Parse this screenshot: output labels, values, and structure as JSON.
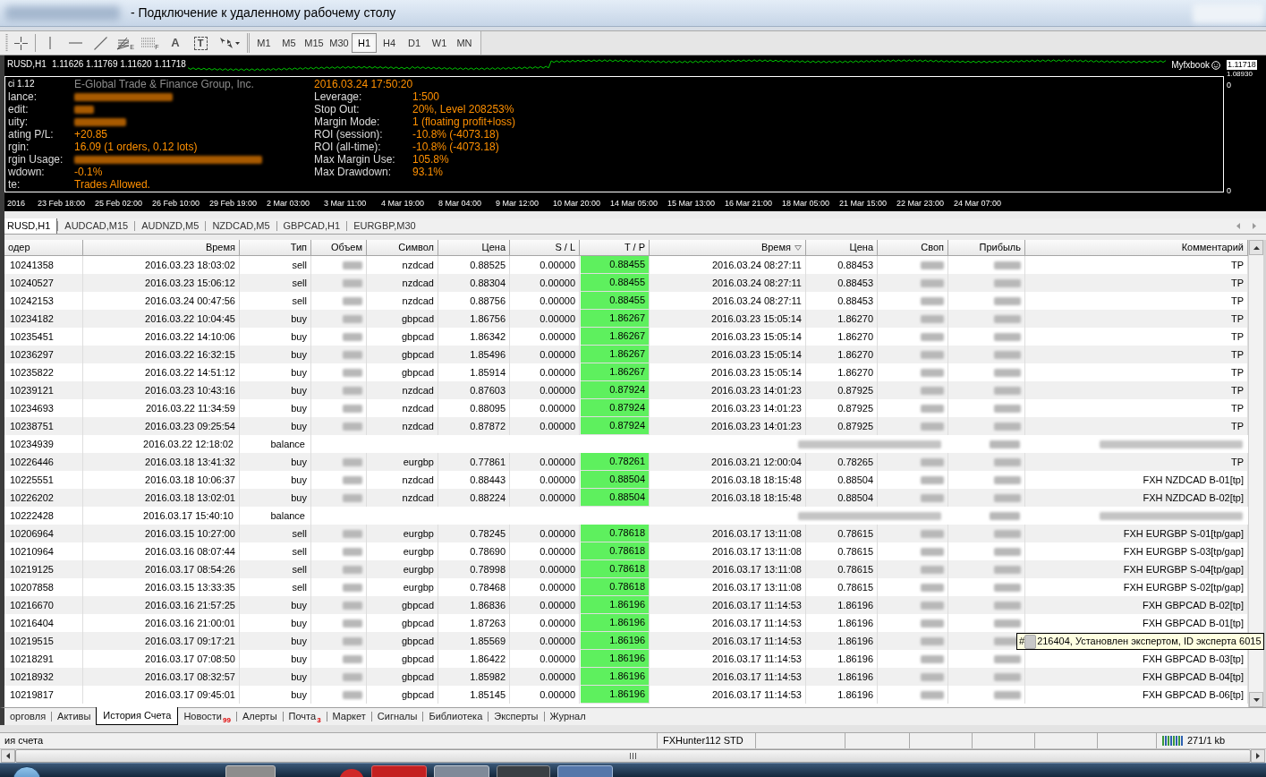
{
  "window": {
    "title": "- Подключение к удаленному рабочему столу"
  },
  "toolbar": {
    "tools": [
      {
        "kind": "crosshair"
      },
      {
        "kind": "vline"
      },
      {
        "kind": "hline"
      },
      {
        "kind": "trendline"
      },
      {
        "kind": "fibo",
        "letter": "E"
      },
      {
        "kind": "channel",
        "letter": "F"
      },
      {
        "kind": "text",
        "label": "A"
      },
      {
        "kind": "label",
        "label": "T"
      },
      {
        "kind": "arrows"
      }
    ]
  },
  "timeframes": [
    {
      "label": "M1",
      "selected": false
    },
    {
      "label": "M5",
      "selected": false
    },
    {
      "label": "M15",
      "selected": false
    },
    {
      "label": "M30",
      "selected": false
    },
    {
      "label": "H1",
      "selected": true
    },
    {
      "label": "H4",
      "selected": false
    },
    {
      "label": "D1",
      "selected": false
    },
    {
      "label": "W1",
      "selected": false
    },
    {
      "label": "MN",
      "selected": false
    }
  ],
  "chart": {
    "symbol": "RUSD,H1",
    "quote": "1.11626 1.11769 1.11620 1.11718",
    "brand": "Myfxbook",
    "price_labels": [
      {
        "text": "1.11718",
        "current": true
      },
      {
        "text": "1.08930",
        "current": false
      }
    ],
    "scale_labels": [
      "0",
      "0"
    ],
    "time_axis": [
      "2016",
      "23 Feb 18:00",
      "25 Feb 02:00",
      "26 Feb 10:00",
      "29 Feb 19:00",
      "2 Mar 03:00",
      "3 Mar 11:00",
      "4 Mar 19:00",
      "8 Mar 04:00",
      "9 Mar 12:00",
      "10 Mar 20:00",
      "14 Mar 05:00",
      "15 Mar 13:00",
      "16 Mar 21:00",
      "18 Mar 05:00",
      "21 Mar 15:00",
      "22 Mar 23:00",
      "24 Mar 07:00"
    ]
  },
  "info_panel": {
    "version": "ci 1.12",
    "broker": "E-Global Trade & Finance Group, Inc.",
    "timestamp": "2016.03.24 17:50:20",
    "account": [
      {
        "label": "lance:",
        "blurred": true
      },
      {
        "label": "edit:",
        "blurred": true
      },
      {
        "label": "uity:",
        "blurred": true
      },
      {
        "label": "ating P/L:",
        "blurred": false,
        "value": "+20.85"
      },
      {
        "label": "rgin:",
        "blurred": false,
        "value": "16.09 (1 orders, 0.12 lots)"
      },
      {
        "label": "rgin Usage:",
        "blurred": true
      },
      {
        "label": "wdown:",
        "blurred": false,
        "value": "-0.1%"
      },
      {
        "label": "te:",
        "blurred": false,
        "value": "Trades Allowed."
      }
    ],
    "stats": [
      {
        "label": "Leverage:",
        "value": "1:500"
      },
      {
        "label": "Stop Out:",
        "value": "20%, Level 208253%"
      },
      {
        "label": "Margin Mode:",
        "value": "1 (floating profit+loss)"
      },
      {
        "label": "ROI (session):",
        "value": "-10.8% (-4073.18)"
      },
      {
        "label": "ROI (all-time):",
        "value": "-10.8% (-4073.18)"
      },
      {
        "label": "Max Margin Use:",
        "value": "105.8%"
      },
      {
        "label": "Max Drawdown:",
        "value": "93.1%"
      }
    ]
  },
  "chart_tabs": [
    {
      "label": "RUSD,H1",
      "selected": true
    },
    {
      "label": "AUDCAD,M15",
      "selected": false
    },
    {
      "label": "AUDNZD,M5",
      "selected": false
    },
    {
      "label": "NZDCAD,M5",
      "selected": false
    },
    {
      "label": "GBPCAD,H1",
      "selected": false
    },
    {
      "label": "EURGBP,M30",
      "selected": false
    }
  ],
  "table": {
    "columns": [
      {
        "label": "одер",
        "kind": "text",
        "sorted": false
      },
      {
        "label": "Время",
        "kind": "text",
        "sorted": false
      },
      {
        "label": "Тип",
        "kind": "text",
        "sorted": false
      },
      {
        "label": "Объем",
        "kind": "blurred",
        "sorted": false
      },
      {
        "label": "Символ",
        "kind": "text",
        "sorted": false
      },
      {
        "label": "Цена",
        "kind": "text",
        "sorted": false
      },
      {
        "label": "S / L",
        "kind": "text",
        "sorted": false
      },
      {
        "label": "T / P",
        "kind": "highlight",
        "sorted": false
      },
      {
        "label": "Время",
        "kind": "text",
        "sorted": true
      },
      {
        "label": "Цена",
        "kind": "text",
        "sorted": false
      },
      {
        "label": "Своп",
        "kind": "blurred",
        "sorted": false
      },
      {
        "label": "Прибыль",
        "kind": "blurred",
        "sorted": false
      },
      {
        "label": "Комментарий",
        "kind": "text",
        "sorted": false
      }
    ],
    "rows": [
      {
        "kind": "trade",
        "cells": [
          "10241358",
          "2016.03.23 18:03:02",
          "sell",
          null,
          "nzdcad",
          "0.88525",
          "0.00000",
          "0.88455",
          "2016.03.24 08:27:11",
          "0.88453",
          null,
          null,
          "TP"
        ]
      },
      {
        "kind": "trade",
        "cells": [
          "10240527",
          "2016.03.23 15:06:12",
          "sell",
          null,
          "nzdcad",
          "0.88304",
          "0.00000",
          "0.88455",
          "2016.03.24 08:27:11",
          "0.88453",
          null,
          null,
          "TP"
        ]
      },
      {
        "kind": "trade",
        "cells": [
          "10242153",
          "2016.03.24 00:47:56",
          "sell",
          null,
          "nzdcad",
          "0.88756",
          "0.00000",
          "0.88455",
          "2016.03.24 08:27:11",
          "0.88453",
          null,
          null,
          "TP"
        ]
      },
      {
        "kind": "trade",
        "cells": [
          "10234182",
          "2016.03.22 10:04:45",
          "buy",
          null,
          "gbpcad",
          "1.86756",
          "0.00000",
          "1.86267",
          "2016.03.23 15:05:14",
          "1.86270",
          null,
          null,
          "TP"
        ]
      },
      {
        "kind": "trade",
        "cells": [
          "10235451",
          "2016.03.22 14:10:06",
          "buy",
          null,
          "gbpcad",
          "1.86342",
          "0.00000",
          "1.86267",
          "2016.03.23 15:05:14",
          "1.86270",
          null,
          null,
          "TP"
        ]
      },
      {
        "kind": "trade",
        "cells": [
          "10236297",
          "2016.03.22 16:32:15",
          "buy",
          null,
          "gbpcad",
          "1.85496",
          "0.00000",
          "1.86267",
          "2016.03.23 15:05:14",
          "1.86270",
          null,
          null,
          "TP"
        ]
      },
      {
        "kind": "trade",
        "cells": [
          "10235822",
          "2016.03.22 14:51:12",
          "buy",
          null,
          "gbpcad",
          "1.85914",
          "0.00000",
          "1.86267",
          "2016.03.23 15:05:14",
          "1.86270",
          null,
          null,
          "TP"
        ]
      },
      {
        "kind": "trade",
        "cells": [
          "10239121",
          "2016.03.23 10:43:16",
          "buy",
          null,
          "nzdcad",
          "0.87603",
          "0.00000",
          "0.87924",
          "2016.03.23 14:01:23",
          "0.87925",
          null,
          null,
          "TP"
        ]
      },
      {
        "kind": "trade",
        "cells": [
          "10234693",
          "2016.03.22 11:34:59",
          "buy",
          null,
          "nzdcad",
          "0.88095",
          "0.00000",
          "0.87924",
          "2016.03.23 14:01:23",
          "0.87925",
          null,
          null,
          "TP"
        ]
      },
      {
        "kind": "trade",
        "cells": [
          "10238751",
          "2016.03.23 09:25:54",
          "buy",
          null,
          "nzdcad",
          "0.87872",
          "0.00000",
          "0.87924",
          "2016.03.23 14:01:23",
          "0.87925",
          null,
          null,
          "TP"
        ]
      },
      {
        "kind": "balance",
        "cells": [
          "10234939",
          "2016.03.22 12:18:02",
          "balance"
        ]
      },
      {
        "kind": "trade",
        "cells": [
          "10226446",
          "2016.03.18 13:41:32",
          "buy",
          null,
          "eurgbp",
          "0.77861",
          "0.00000",
          "0.78261",
          "2016.03.21 12:00:04",
          "0.78265",
          null,
          null,
          "TP"
        ]
      },
      {
        "kind": "trade",
        "cells": [
          "10225551",
          "2016.03.18 10:06:37",
          "buy",
          null,
          "nzdcad",
          "0.88443",
          "0.00000",
          "0.88504",
          "2016.03.18 18:15:48",
          "0.88504",
          null,
          null,
          "FXH NZDCAD B-01[tp]"
        ]
      },
      {
        "kind": "trade",
        "cells": [
          "10226202",
          "2016.03.18 13:02:01",
          "buy",
          null,
          "nzdcad",
          "0.88224",
          "0.00000",
          "0.88504",
          "2016.03.18 18:15:48",
          "0.88504",
          null,
          null,
          "FXH NZDCAD B-02[tp]"
        ]
      },
      {
        "kind": "balance",
        "cells": [
          "10222428",
          "2016.03.17 15:40:10",
          "balance"
        ]
      },
      {
        "kind": "trade",
        "cells": [
          "10206964",
          "2016.03.15 10:27:00",
          "sell",
          null,
          "eurgbp",
          "0.78245",
          "0.00000",
          "0.78618",
          "2016.03.17 13:11:08",
          "0.78615",
          null,
          null,
          "FXH EURGBP S-01[tp/gap]"
        ]
      },
      {
        "kind": "trade",
        "cells": [
          "10210964",
          "2016.03.16 08:07:44",
          "sell",
          null,
          "eurgbp",
          "0.78690",
          "0.00000",
          "0.78618",
          "2016.03.17 13:11:08",
          "0.78615",
          null,
          null,
          "FXH EURGBP S-03[tp/gap]"
        ]
      },
      {
        "kind": "trade",
        "cells": [
          "10219125",
          "2016.03.17 08:54:26",
          "sell",
          null,
          "eurgbp",
          "0.78998",
          "0.00000",
          "0.78618",
          "2016.03.17 13:11:08",
          "0.78615",
          null,
          null,
          "FXH EURGBP S-04[tp/gap]"
        ]
      },
      {
        "kind": "trade",
        "cells": [
          "10207858",
          "2016.03.15 13:33:35",
          "sell",
          null,
          "eurgbp",
          "0.78468",
          "0.00000",
          "0.78618",
          "2016.03.17 13:11:08",
          "0.78615",
          null,
          null,
          "FXH EURGBP S-02[tp/gap]"
        ]
      },
      {
        "kind": "trade",
        "cells": [
          "10216670",
          "2016.03.16 21:57:25",
          "buy",
          null,
          "gbpcad",
          "1.86836",
          "0.00000",
          "1.86196",
          "2016.03.17 11:14:53",
          "1.86196",
          null,
          null,
          "FXH GBPCAD B-02[tp]"
        ]
      },
      {
        "kind": "trade",
        "cells": [
          "10216404",
          "2016.03.16 21:00:01",
          "buy",
          null,
          "gbpcad",
          "1.87263",
          "0.00000",
          "1.86196",
          "2016.03.17 11:14:53",
          "1.86196",
          null,
          null,
          "FXH GBPCAD B-01[tp]"
        ]
      },
      {
        "kind": "trade",
        "cells": [
          "10219515",
          "2016.03.17 09:17:21",
          "buy",
          null,
          "gbpcad",
          "1.85569",
          "0.00000",
          "1.86196",
          "2016.03.17 11:14:53",
          "1.86196",
          null,
          null,
          null
        ],
        "tooltip": {
          "prefix": "#",
          "text": "216404, Установлен экспертом, ID эксперта 6015"
        }
      },
      {
        "kind": "trade",
        "cells": [
          "10218291",
          "2016.03.17 07:08:50",
          "buy",
          null,
          "gbpcad",
          "1.86422",
          "0.00000",
          "1.86196",
          "2016.03.17 11:14:53",
          "1.86196",
          null,
          null,
          "FXH GBPCAD B-03[tp]"
        ]
      },
      {
        "kind": "trade",
        "cells": [
          "10218932",
          "2016.03.17 08:32:57",
          "buy",
          null,
          "gbpcad",
          "1.85982",
          "0.00000",
          "1.86196",
          "2016.03.17 11:14:53",
          "1.86196",
          null,
          null,
          "FXH GBPCAD B-04[tp]"
        ]
      },
      {
        "kind": "trade",
        "cells": [
          "10219817",
          "2016.03.17 09:45:01",
          "buy",
          null,
          "gbpcad",
          "1.85145",
          "0.00000",
          "1.86196",
          "2016.03.17 11:14:53",
          "1.86196",
          null,
          null,
          "FXH GBPCAD B-06[tp]"
        ]
      }
    ]
  },
  "bottom_tabs": [
    {
      "label": "орговля",
      "selected": false
    },
    {
      "label": "Активы",
      "selected": false
    },
    {
      "label": "История Счета",
      "selected": true
    },
    {
      "label": "Новости",
      "selected": false,
      "badge": "99"
    },
    {
      "label": "Алерты",
      "selected": false
    },
    {
      "label": "Почта",
      "selected": false,
      "badge": "3"
    },
    {
      "label": "Маркет",
      "selected": false
    },
    {
      "label": "Сигналы",
      "selected": false
    },
    {
      "label": "Библиотека",
      "selected": false
    },
    {
      "label": "Эксперты",
      "selected": false
    },
    {
      "label": "Журнал",
      "selected": false
    }
  ],
  "status_bar": {
    "section": "ия счета",
    "profile": "FXHunter112 STD",
    "traffic": "271/1 kb"
  }
}
